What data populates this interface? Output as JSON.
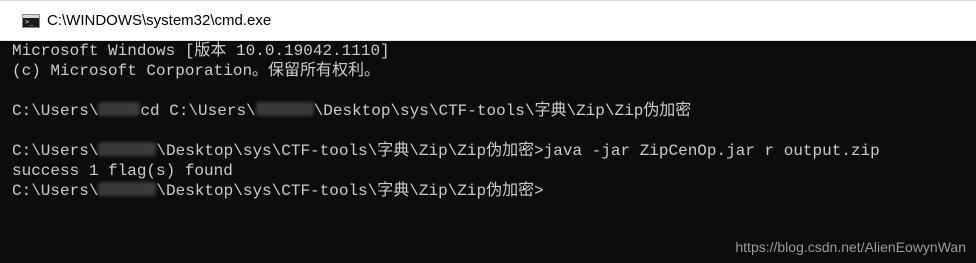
{
  "window": {
    "title": "C:\\WINDOWS\\system32\\cmd.exe",
    "icon": "cmd-prompt-icon"
  },
  "console": {
    "line1": "Microsoft Windows [版本 10.0.19042.1110]",
    "line2": "(c) Microsoft Corporation。保留所有权利。",
    "line4_prefix": "C:\\Users\\",
    "line4_mid": "cd C:\\Users\\",
    "line4_suffix": "\\Desktop\\sys\\CTF-tools\\字典\\Zip\\Zip伪加密",
    "line6_prefix": "C:\\Users\\",
    "line6_suffix": "\\Desktop\\sys\\CTF-tools\\字典\\Zip\\Zip伪加密>java -jar ZipCenOp.jar r output.zip",
    "line7": "success 1 flag(s) found",
    "line8_prefix": "C:\\Users\\",
    "line8_suffix": "\\Desktop\\sys\\CTF-tools\\字典\\Zip\\Zip伪加密>"
  },
  "watermark": "https://blog.csdn.net/AlienEowynWan",
  "colors": {
    "console_background": "#0c0c0c",
    "console_text": "#cccccc",
    "titlebar_background": "#ffffff"
  }
}
